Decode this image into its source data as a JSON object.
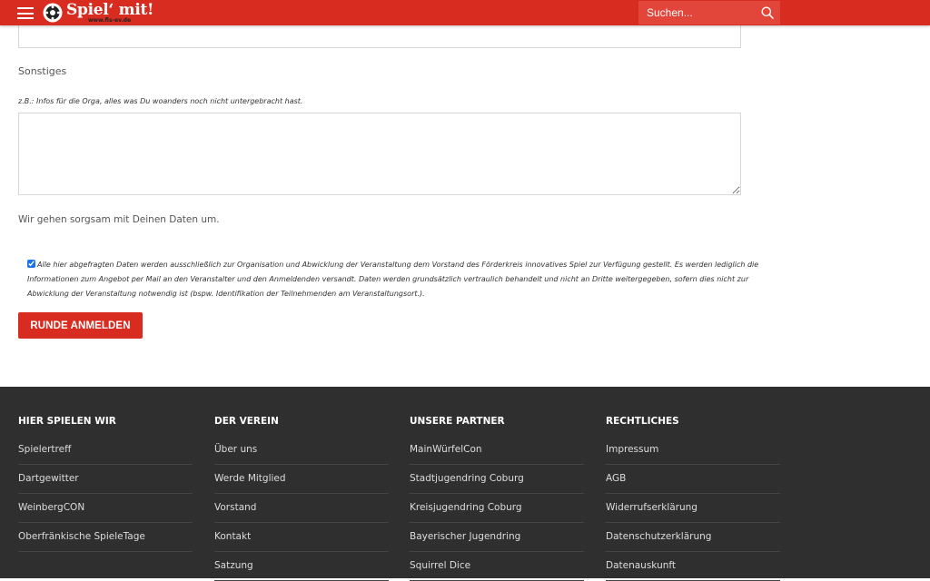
{
  "header": {
    "logo_text": "Spiel‘ mit!",
    "logo_url": "www.fis-ev.de",
    "search_placeholder": "Suchen..."
  },
  "form": {
    "sonstiges_label": "Sonstiges",
    "sonstiges_hint": "z.B.: Infos für die Orga, alles was Du woanders noch nicht untergebracht hast.",
    "sonstiges_value": "",
    "privacy_note": "Wir gehen sorgsam mit Deinen Daten um.",
    "consent_checked": true,
    "consent_text": "Alle hier abgefragten Daten werden ausschließlich zur Organisation und Abwicklung der Veranstaltung dem Vorstand des Förderkreis innovatives Spiel zur Verfügung gestellt. Es werden lediglich die Informationen zum Angebot per Mail an den Veranstalter und den Anmeldenden versandt. Daten werden grundsätzlich vertraulich behandelt und nicht an Dritte weitergegeben, sofern dies nicht zur Abwicklung der Veranstaltung notwendig ist (bspw. Identifikation der Teilnehmenden am Veranstaltungsort.).",
    "submit_label": "RUNDE ANMELDEN"
  },
  "footer": {
    "columns": [
      {
        "title": "HIER SPIELEN WIR",
        "links": [
          "Spielertreff",
          "Dartgewitter",
          "WeinbergCON",
          "Oberfränkische SpieleTage"
        ]
      },
      {
        "title": "DER VEREIN",
        "links": [
          "Über uns",
          "Werde Mitglied",
          "Vorstand",
          "Kontakt",
          "Satzung"
        ]
      },
      {
        "title": "UNSERE PARTNER",
        "links": [
          "MainWürfelCon",
          "Stadtjugendring Coburg",
          "Kreisjugendring Coburg",
          "Bayerischer Jugendring",
          "Squirrel Dice"
        ]
      },
      {
        "title": "RECHTLICHES",
        "links": [
          "Impressum",
          "AGB",
          "Widerrufserklärung",
          "Datenschutzerklärung",
          "Datenauskunft"
        ]
      }
    ]
  },
  "colors": {
    "brand_red": "#d82c20",
    "footer_bg": "#2f2f2f"
  }
}
